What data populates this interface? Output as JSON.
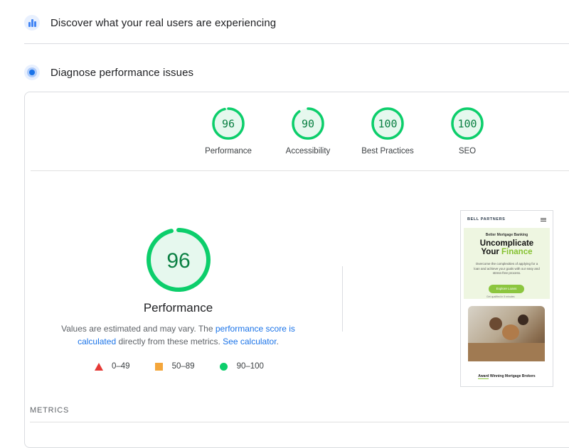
{
  "sections": {
    "crux_title": "Discover what your real users are experiencing",
    "diagnose_title": "Diagnose performance issues"
  },
  "scores": [
    {
      "label": "Performance",
      "value": "96",
      "fraction": 0.96
    },
    {
      "label": "Accessibility",
      "value": "90",
      "fraction": 0.9
    },
    {
      "label": "Best Practices",
      "value": "100",
      "fraction": 1.0
    },
    {
      "label": "SEO",
      "value": "100",
      "fraction": 1.0
    }
  ],
  "performance": {
    "score": "96",
    "fraction": 0.96,
    "title": "Performance",
    "desc_prefix": "Values are estimated and may vary. The ",
    "desc_link": "performance score is calculated",
    "desc_mid": " directly from these metrics. ",
    "desc_link2": "See calculator",
    "desc_suffix": "."
  },
  "legend": {
    "fail": "0–49",
    "average": "50–89",
    "pass": "90–100"
  },
  "colors": {
    "pass": "#0cce6b",
    "pass_text": "#0b8043",
    "pass_fill": "#e6f8ee",
    "fail": "#e53935",
    "average": "#f4a63b",
    "link": "#1a73e8"
  },
  "screenshot": {
    "brand": "BELL PARTNERS",
    "subheading": "Better Mortgage Banking",
    "headline_line1": "Uncomplicate",
    "headline_line2a": "Your ",
    "headline_line2b": "Finance",
    "body": "Overcome the complexities of applying for a loan and achieve your goals with our easy and stress-free process.",
    "button": "Explore Loans",
    "note": "Get qualified in 5 minutes",
    "footer_a": "Award",
    "footer_b": " Winning Mortgage Brokers"
  },
  "metrics_header": "METRICS"
}
